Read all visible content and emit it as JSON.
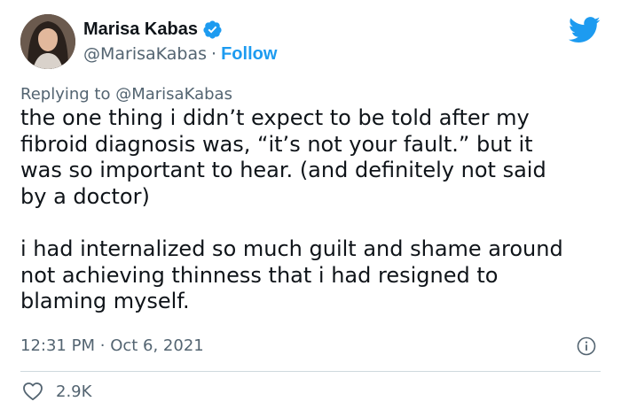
{
  "author": {
    "display_name": "Marisa Kabas",
    "handle": "@MarisaKabas",
    "separator": "·",
    "follow_label": "Follow"
  },
  "reply_context": {
    "prefix": "Replying to",
    "handle": "@MarisaKabas"
  },
  "tweet": {
    "lines_p1": [
      "the one thing i didn’t expect to be told after my",
      "fibroid diagnosis was, “it’s not your fault.” but it",
      "was so important to hear. (and definitely not said",
      "by a doctor)"
    ],
    "lines_p2": [
      "i had internalized so much guilt and shame around",
      "not achieving thinness that i had resigned to",
      "blaming myself."
    ]
  },
  "meta": {
    "time": "12:31 PM",
    "separator": "·",
    "date": "Oct 6, 2021"
  },
  "actions": {
    "like_count": "2.9K"
  },
  "colors": {
    "accent": "#1d9bf0",
    "secondary_text": "#536471",
    "divider": "#cfd9de"
  },
  "icons": [
    "verified-badge-icon",
    "twitter-bird-icon",
    "info-icon",
    "heart-icon"
  ]
}
